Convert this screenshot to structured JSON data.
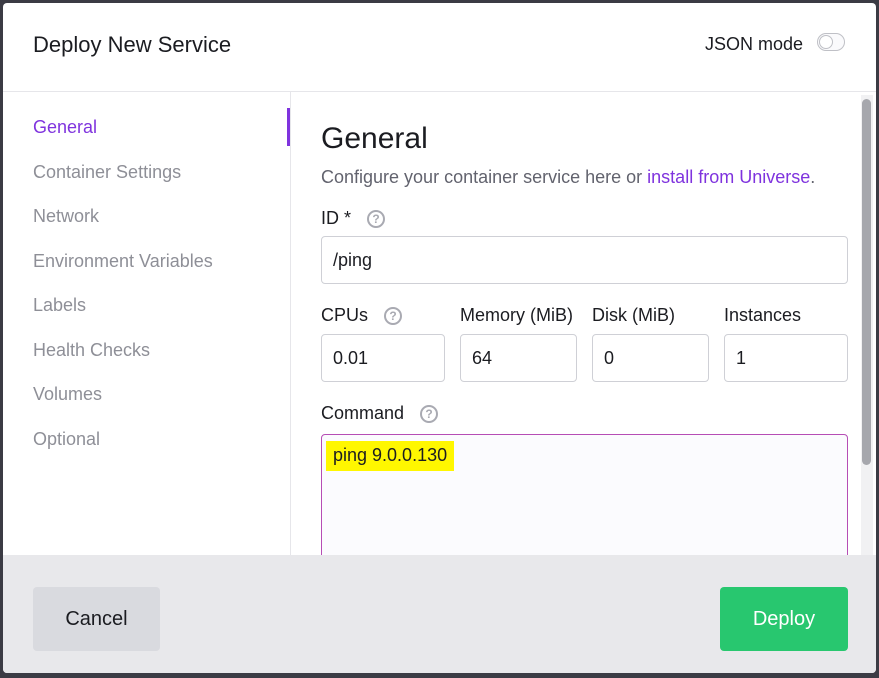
{
  "header": {
    "title": "Deploy New Service",
    "json_mode_label": "JSON mode",
    "json_mode_enabled": false
  },
  "sidebar": {
    "items": [
      {
        "label": "General",
        "active": true
      },
      {
        "label": "Container Settings",
        "active": false
      },
      {
        "label": "Network",
        "active": false
      },
      {
        "label": "Environment Variables",
        "active": false
      },
      {
        "label": "Labels",
        "active": false
      },
      {
        "label": "Health Checks",
        "active": false
      },
      {
        "label": "Volumes",
        "active": false
      },
      {
        "label": "Optional",
        "active": false
      }
    ]
  },
  "general": {
    "title": "General",
    "subtitle_prefix": "Configure your container service here or ",
    "subtitle_link": "install from Universe",
    "subtitle_suffix": ".",
    "id_label": "ID *",
    "id_value": "/ping",
    "cpus_label": "CPUs",
    "cpus_value": "0.01",
    "memory_label": "Memory (MiB)",
    "memory_value": "64",
    "disk_label": "Disk (MiB)",
    "disk_value": "0",
    "instances_label": "Instances",
    "instances_value": "1",
    "command_label": "Command",
    "command_value": "ping 9.0.0.130"
  },
  "footer": {
    "cancel_label": "Cancel",
    "deploy_label": "Deploy"
  },
  "colors": {
    "accent": "#7f33de",
    "deploy": "#28c76f",
    "highlight": "#fff700"
  },
  "icons": {
    "help": "question-circle-icon"
  }
}
